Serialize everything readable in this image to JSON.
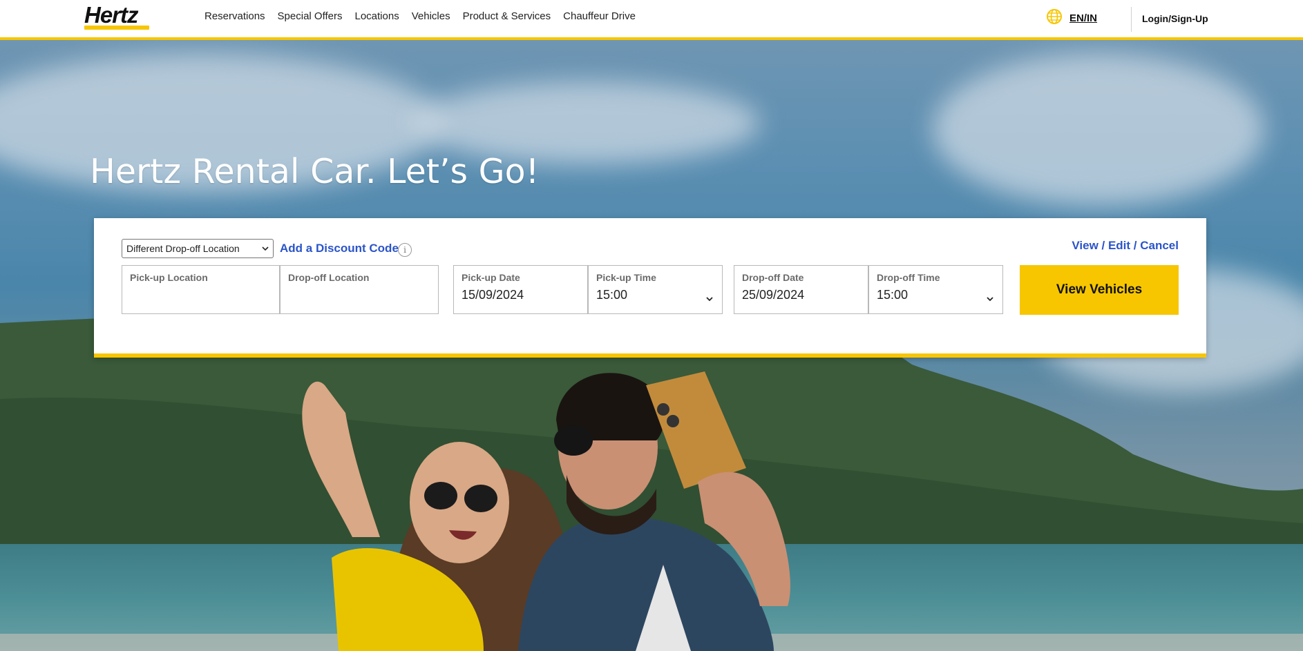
{
  "brand": {
    "logo_text": "Hertz",
    "accent_color": "#f7c600",
    "link_color": "#2a54c9"
  },
  "nav": {
    "items": [
      {
        "label": "Reservations"
      },
      {
        "label": "Special Offers"
      },
      {
        "label": "Locations"
      },
      {
        "label": "Vehicles"
      },
      {
        "label": "Product & Services"
      },
      {
        "label": "Chauffeur Drive"
      }
    ]
  },
  "header": {
    "language": "EN/IN",
    "login_label": "Login/Sign-Up",
    "globe_icon": "globe-icon"
  },
  "hero": {
    "title": "Hertz Rental Car. Let’s Go!"
  },
  "booking": {
    "dropoff_mode": {
      "selected": "Different Drop-off Location"
    },
    "discount_link": "Add a Discount Code",
    "info_icon": "i",
    "view_edit_cancel": "View / Edit / Cancel",
    "pickup_location": {
      "label": "Pick-up Location",
      "value": ""
    },
    "dropoff_location": {
      "label": "Drop-off Location",
      "value": ""
    },
    "pickup_date": {
      "label": "Pick-up Date",
      "value": "15/09/2024"
    },
    "pickup_time": {
      "label": "Pick-up Time",
      "value": "15:00"
    },
    "dropoff_date": {
      "label": "Drop-off Date",
      "value": "25/09/2024"
    },
    "dropoff_time": {
      "label": "Drop-off Time",
      "value": "15:00"
    },
    "submit_label": "View Vehicles"
  }
}
